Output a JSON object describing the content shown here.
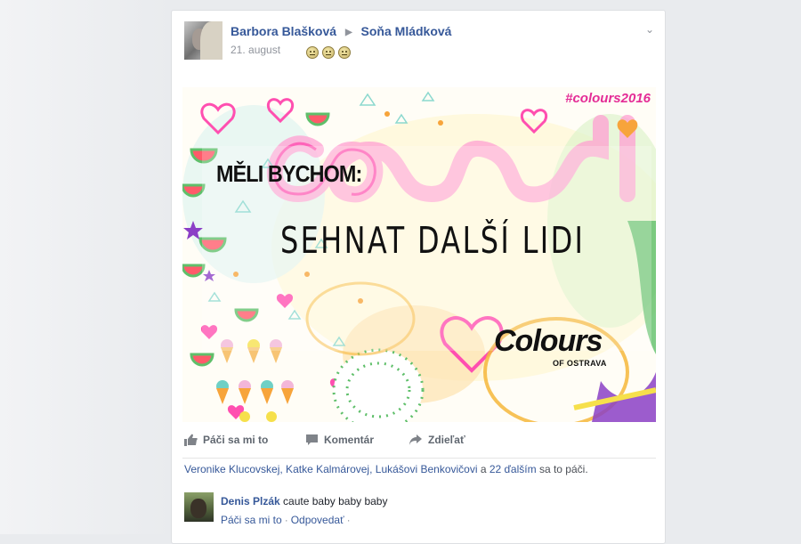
{
  "post": {
    "author": "Barbora Blašková",
    "recipient": "Soňa Mládková",
    "date": "21. august",
    "reaction_emojis": [
      "emoji-face",
      "emoji-face",
      "emoji-face"
    ]
  },
  "image": {
    "hashtag": "#colours2016",
    "headline": "MĚLI BYCHOM:",
    "message": "SEHNAT DALŠÍ LIDI",
    "logo_text": "Colours",
    "logo_subtext": "OF OSTRAVA",
    "palette": {
      "pink": "#ff4fb0",
      "magenta": "#e42c96",
      "orange": "#f7a43b",
      "green": "#5fbf6a",
      "teal": "#6fd0c5",
      "yellow": "#f6e04b",
      "purple": "#8b3fc6"
    }
  },
  "actions": {
    "like": "Páči sa mi to",
    "comment": "Komentár",
    "share": "Zdieľať"
  },
  "reactions": {
    "names": "Veronike Klucovskej, Katke Kalmárovej, Lukášovi Benkovičovi",
    "conjunction": "a",
    "others": "22 ďalším",
    "suffix": "sa to páči."
  },
  "comment": {
    "author": "Denis Plzák",
    "text": "caute baby baby baby",
    "like": "Páči sa mi to",
    "reply": "Odpovedať",
    "separator": "·"
  },
  "colors": {
    "link": "#365899",
    "muted": "#90949c",
    "background": "#e9ebee"
  }
}
